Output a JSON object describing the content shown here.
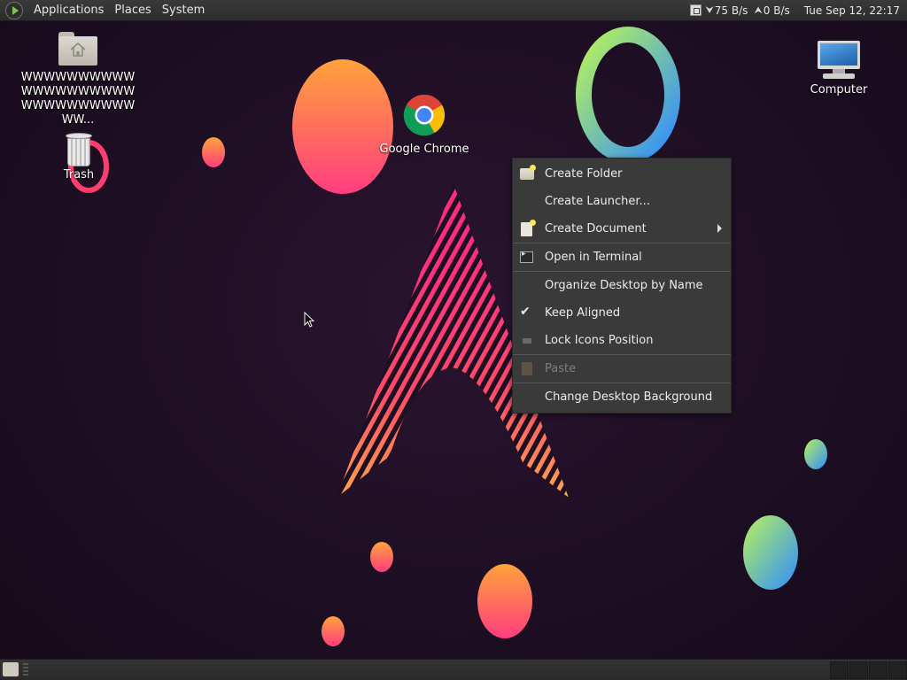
{
  "top_panel": {
    "menus": [
      "Applications",
      "Places",
      "System"
    ],
    "net_down": "75 B/s",
    "net_up": "0 B/s",
    "clock": "Tue Sep 12, 22:17"
  },
  "desktop": {
    "home_label": "WWWWWWWWWWWWWWWWWWWWWWWWWWWWWWWW...",
    "trash_label": "Trash",
    "chrome_label": "Google Chrome",
    "computer_label": "Computer"
  },
  "context_menu": {
    "items": [
      {
        "label": "Create Folder",
        "icon": "folder-new-icon"
      },
      {
        "label": "Create Launcher...",
        "icon": ""
      },
      {
        "label": "Create Document",
        "icon": "document-new-icon",
        "submenu": true
      },
      {
        "label": "Open in Terminal",
        "icon": "terminal-icon"
      },
      {
        "label": "Organize Desktop by Name",
        "icon": ""
      },
      {
        "label": "Keep Aligned",
        "icon": "checkmark-icon",
        "checked": true
      },
      {
        "label": "Lock Icons Position",
        "icon": "lock-icon"
      },
      {
        "label": "Paste",
        "icon": "paste-icon",
        "disabled": true
      },
      {
        "label": "Change Desktop Background",
        "icon": ""
      }
    ]
  },
  "colors": {
    "panel_bg": "#2c2c2c",
    "menu_bg": "#3a3a3a",
    "wallpaper_bg": "#1e0f22"
  }
}
